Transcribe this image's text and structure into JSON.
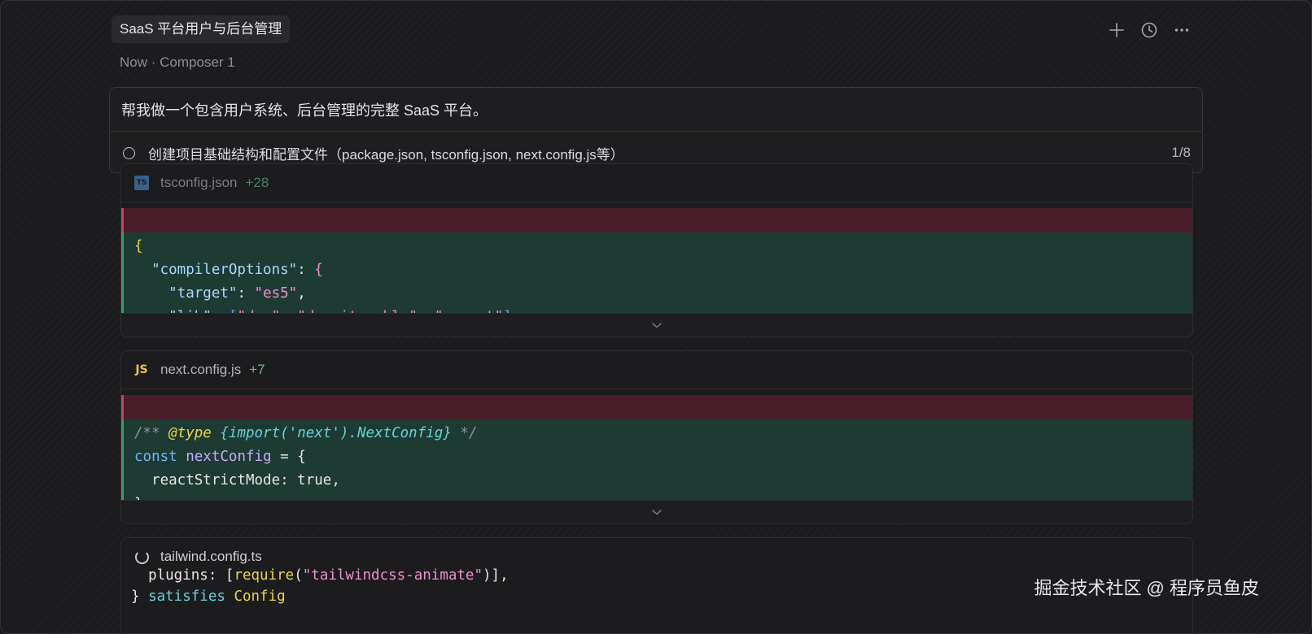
{
  "header": {
    "title": "SaaS 平台用户与后台管理",
    "icons": [
      "plus-icon",
      "history-icon",
      "more-icon"
    ]
  },
  "subtitle": {
    "time": "Now",
    "separator": "·",
    "composer": "Composer 1"
  },
  "prompt": {
    "text": "帮我做一个包含用户系统、后台管理的完整 SaaS 平台。",
    "task": {
      "label": "创建项目基础结构和配置文件（package.json, tsconfig.json, next.config.js等）",
      "progress": "1/8"
    }
  },
  "files": [
    {
      "icon": "TS",
      "name": "tsconfig.json",
      "added": "+28",
      "lines": [
        [
          {
            "t": "{",
            "c": "brace"
          }
        ],
        [
          {
            "t": "  ",
            "c": "punct"
          },
          {
            "t": "\"compilerOptions\"",
            "c": "key"
          },
          {
            "t": ": ",
            "c": "punct"
          },
          {
            "t": "{",
            "c": "str"
          }
        ],
        [
          {
            "t": "    ",
            "c": "punct"
          },
          {
            "t": "\"target\"",
            "c": "key"
          },
          {
            "t": ": ",
            "c": "punct"
          },
          {
            "t": "\"es5\"",
            "c": "str"
          },
          {
            "t": ",",
            "c": "punct"
          }
        ],
        [
          {
            "t": "    ",
            "c": "punct"
          },
          {
            "t": "\"lib\"",
            "c": "key"
          },
          {
            "t": ": ",
            "c": "punct"
          },
          {
            "t": "[",
            "c": "arr"
          },
          {
            "t": "\"dom\"",
            "c": "str"
          },
          {
            "t": ", ",
            "c": "punct"
          },
          {
            "t": "\"dom.iterable\"",
            "c": "str"
          },
          {
            "t": ", ",
            "c": "punct"
          },
          {
            "t": "\"esnext\"",
            "c": "str"
          },
          {
            "t": "],",
            "c": "arr"
          }
        ]
      ]
    },
    {
      "icon": "JS",
      "name": "next.config.js",
      "added": "+7",
      "lines": [
        [
          {
            "t": "/** ",
            "c": "comment"
          },
          {
            "t": "@type",
            "c": "tag"
          },
          {
            "t": " {import('next').NextConfig}",
            "c": "type"
          },
          {
            "t": " */",
            "c": "comment"
          }
        ],
        [
          {
            "t": "const",
            "c": "kw"
          },
          {
            "t": " ",
            "c": "punct"
          },
          {
            "t": "nextConfig",
            "c": "ident"
          },
          {
            "t": " = {",
            "c": "punct"
          }
        ],
        [
          {
            "t": "  reactStrictMode: true,",
            "c": "punct"
          }
        ],
        [
          {
            "t": "}",
            "c": "punct"
          }
        ]
      ]
    },
    {
      "icon": "spinner",
      "name": "tailwind.config.ts",
      "lines": [
        [
          {
            "t": "  plugins: [",
            "c": "punct"
          },
          {
            "t": "require",
            "c": "fn"
          },
          {
            "t": "(",
            "c": "punct"
          },
          {
            "t": "\"tailwindcss-animate\"",
            "c": "str"
          },
          {
            "t": ")],",
            "c": "punct"
          }
        ],
        [
          {
            "t": "} ",
            "c": "punct"
          },
          {
            "t": "satisfies",
            "c": "kw2"
          },
          {
            "t": " ",
            "c": "punct"
          },
          {
            "t": "Config",
            "c": "type2"
          }
        ]
      ]
    }
  ],
  "watermark": "掘金技术社区 @ 程序员鱼皮",
  "colors": {
    "background": "#1b1b1d",
    "removed": "#4a1d2a",
    "added": "#1e3b33",
    "accent_add": "#6fb38a"
  }
}
